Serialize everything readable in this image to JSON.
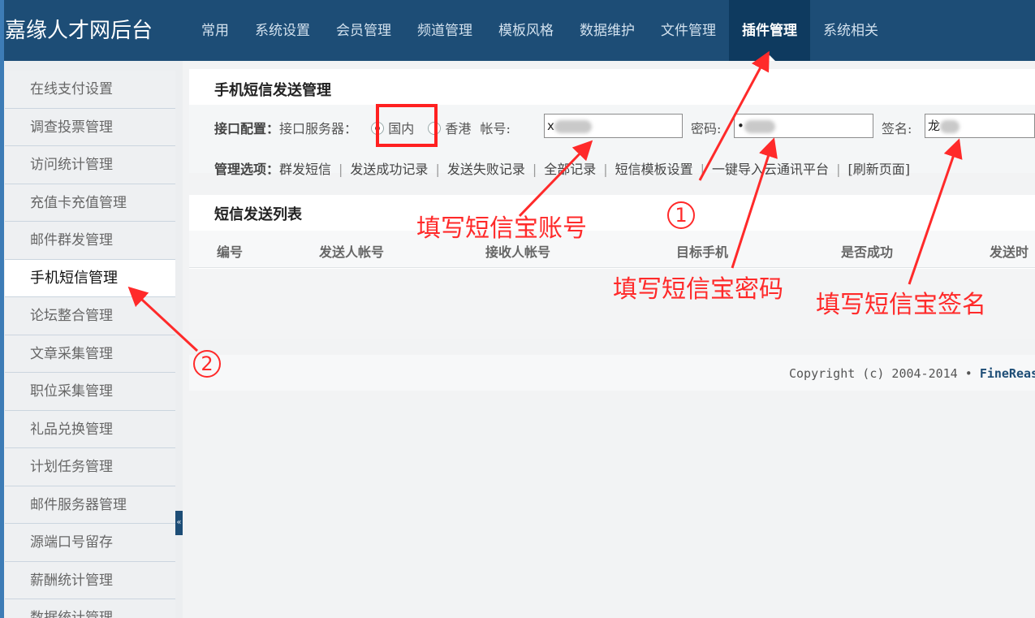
{
  "brand": "嘉缘人才网后台",
  "nav": {
    "items": [
      "常用",
      "系统设置",
      "会员管理",
      "频道管理",
      "模板风格",
      "数据维护",
      "文件管理",
      "插件管理",
      "系统相关"
    ],
    "active_index": 7
  },
  "sidebar": {
    "items": [
      "在线支付设置",
      "调查投票管理",
      "访问统计管理",
      "充值卡充值管理",
      "邮件群发管理",
      "手机短信管理",
      "论坛整合管理",
      "文章采集管理",
      "职位采集管理",
      "礼品兑换管理",
      "计划任务管理",
      "邮件服务器管理",
      "源端口号留存",
      "薪酬统计管理",
      "数据统计管理"
    ],
    "active_index": 5,
    "collapse_glyph": "«"
  },
  "sms_panel": {
    "title": "手机短信发送管理",
    "config_label": "接口配置：",
    "server_label": "接口服务器：",
    "server_options": [
      "国内",
      "香港"
    ],
    "server_selected": "国内",
    "account_label": "帐号:",
    "account_value": "x",
    "password_label": "密码:",
    "password_value": "•",
    "signature_label": "签名:",
    "signature_value": "龙",
    "options_label": "管理选项：",
    "options": [
      "群发短信",
      "发送成功记录",
      "发送失败记录",
      "全部记录",
      "短信模板设置",
      "一键导入云通讯平台",
      "[刷新页面]"
    ]
  },
  "list_panel": {
    "title": "短信发送列表",
    "columns": [
      "编号",
      "发送人帐号",
      "接收人帐号",
      "目标手机",
      "是否成功",
      "发送时"
    ]
  },
  "footer": {
    "copyright": "Copyright (c) 2004-2014",
    "bullet": "•",
    "link": "FineReasc"
  },
  "annotations": {
    "account_hint": "填写短信宝账号",
    "password_hint": "填写短信宝密码",
    "signature_hint": "填写短信宝签名",
    "step1": "1",
    "step2": "2",
    "color": "#ff2a2a"
  }
}
